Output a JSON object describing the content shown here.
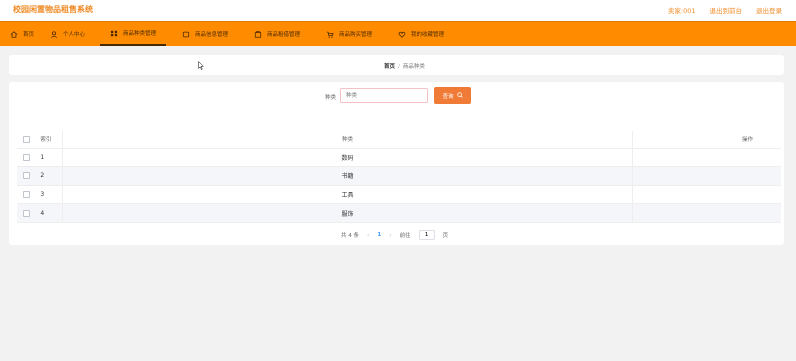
{
  "header": {
    "app_title": "校园闲置物品租售系统",
    "user_text": "卖家:001",
    "back_link": "退出到前台",
    "logout_link": "退出登录"
  },
  "nav": {
    "items": [
      {
        "label": "首页",
        "icon": "home-icon"
      },
      {
        "label": "个人中心",
        "icon": "user-icon"
      },
      {
        "label": "商品种类管理",
        "icon": "category-icon",
        "active": true
      },
      {
        "label": "商品信息管理",
        "icon": "product-icon"
      },
      {
        "label": "商品租借管理",
        "icon": "rent-icon"
      },
      {
        "label": "商品购买管理",
        "icon": "purchase-icon"
      },
      {
        "label": "我的收藏管理",
        "icon": "favorite-icon"
      }
    ]
  },
  "breadcrumb": {
    "home": "首页",
    "current": "商品种类"
  },
  "search": {
    "label": "种类",
    "placeholder": "种类",
    "button_label": "查询"
  },
  "table": {
    "headers": {
      "index": "索引",
      "category": "种类",
      "actions": "操作"
    },
    "rows": [
      {
        "index": "1",
        "category": "数码"
      },
      {
        "index": "2",
        "category": "书籍"
      },
      {
        "index": "3",
        "category": "工具"
      },
      {
        "index": "4",
        "category": "服饰"
      }
    ]
  },
  "pagination": {
    "total_text": "共 4 条",
    "prev": "‹",
    "current_page": "1",
    "next": "›",
    "goto_label": "前往",
    "goto_value": "1",
    "page_suffix": "页"
  },
  "colors": {
    "accent": "#ff8c00",
    "title": "#f08a24",
    "button": "#f07b36"
  }
}
